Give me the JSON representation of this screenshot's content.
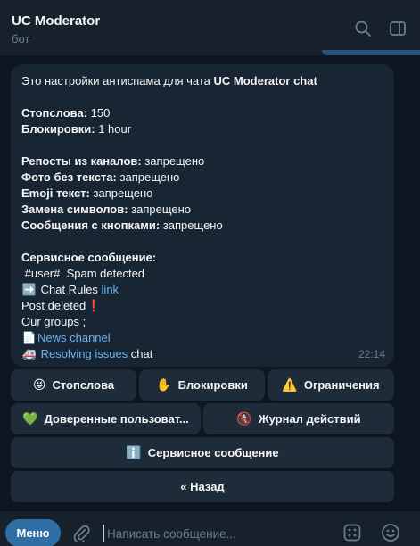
{
  "header": {
    "title": "UC Moderator",
    "subtitle": "бот"
  },
  "message": {
    "intro_text": "Это настройки антиспама для чата ",
    "chat_name": "UC Moderator chat",
    "stopwords_label": "Стопслова:",
    "stopwords_value": " 150",
    "blocks_label": "Блокировки:",
    "blocks_value": " 1 hour",
    "settings": [
      {
        "label": "Репосты из каналов:",
        "value": " запрещено"
      },
      {
        "label": "Фото без текста:",
        "value": " запрещено"
      },
      {
        "label": "Emoji текст:",
        "value": " запрещено"
      },
      {
        "label": "Замена символов:",
        "value": " запрещено"
      },
      {
        "label": "Сообщения с кнопками:",
        "value": " запрещено"
      }
    ],
    "service_label": "Сервисное сообщение:",
    "service_line1": " #user#  Spam detected",
    "rules_text": " Chat Rules ",
    "rules_link": "link",
    "post_deleted": "Post deleted",
    "groups_text": "Our groups ;",
    "news_link": "News channel",
    "issues_link": "Resolving issues",
    "issues_suffix": " chat",
    "time": "22:14",
    "emoji_arrow": "➡️",
    "emoji_exclaim": "❗",
    "emoji_page": "📄",
    "emoji_ambulance": "🚑"
  },
  "keyboard": {
    "stopwords": {
      "icon": "😝",
      "label": "Стопслова"
    },
    "blocks": {
      "icon": "✋",
      "label": "Блокировки"
    },
    "limits": {
      "icon": "⚠️",
      "label": "Ограничения"
    },
    "trusted": {
      "icon": "💚",
      "label": "Доверенные пользоват..."
    },
    "log": {
      "icon": "🚷",
      "label": "Журнал действий"
    },
    "service": {
      "icon": "ℹ️",
      "label": "Сервисное сообщение"
    },
    "back": {
      "label": "« Назад"
    }
  },
  "composer": {
    "menu_label": "Меню",
    "placeholder": "Написать сообщение..."
  },
  "colors": {
    "background": "#0e1621",
    "bubble": "#182533",
    "link": "#6ab3f3",
    "menu_button": "#2f6ea5"
  },
  "icons": [
    "search-icon",
    "sidebar-toggle-icon",
    "attach-icon",
    "bot-commands-icon",
    "emoji-icon"
  ]
}
